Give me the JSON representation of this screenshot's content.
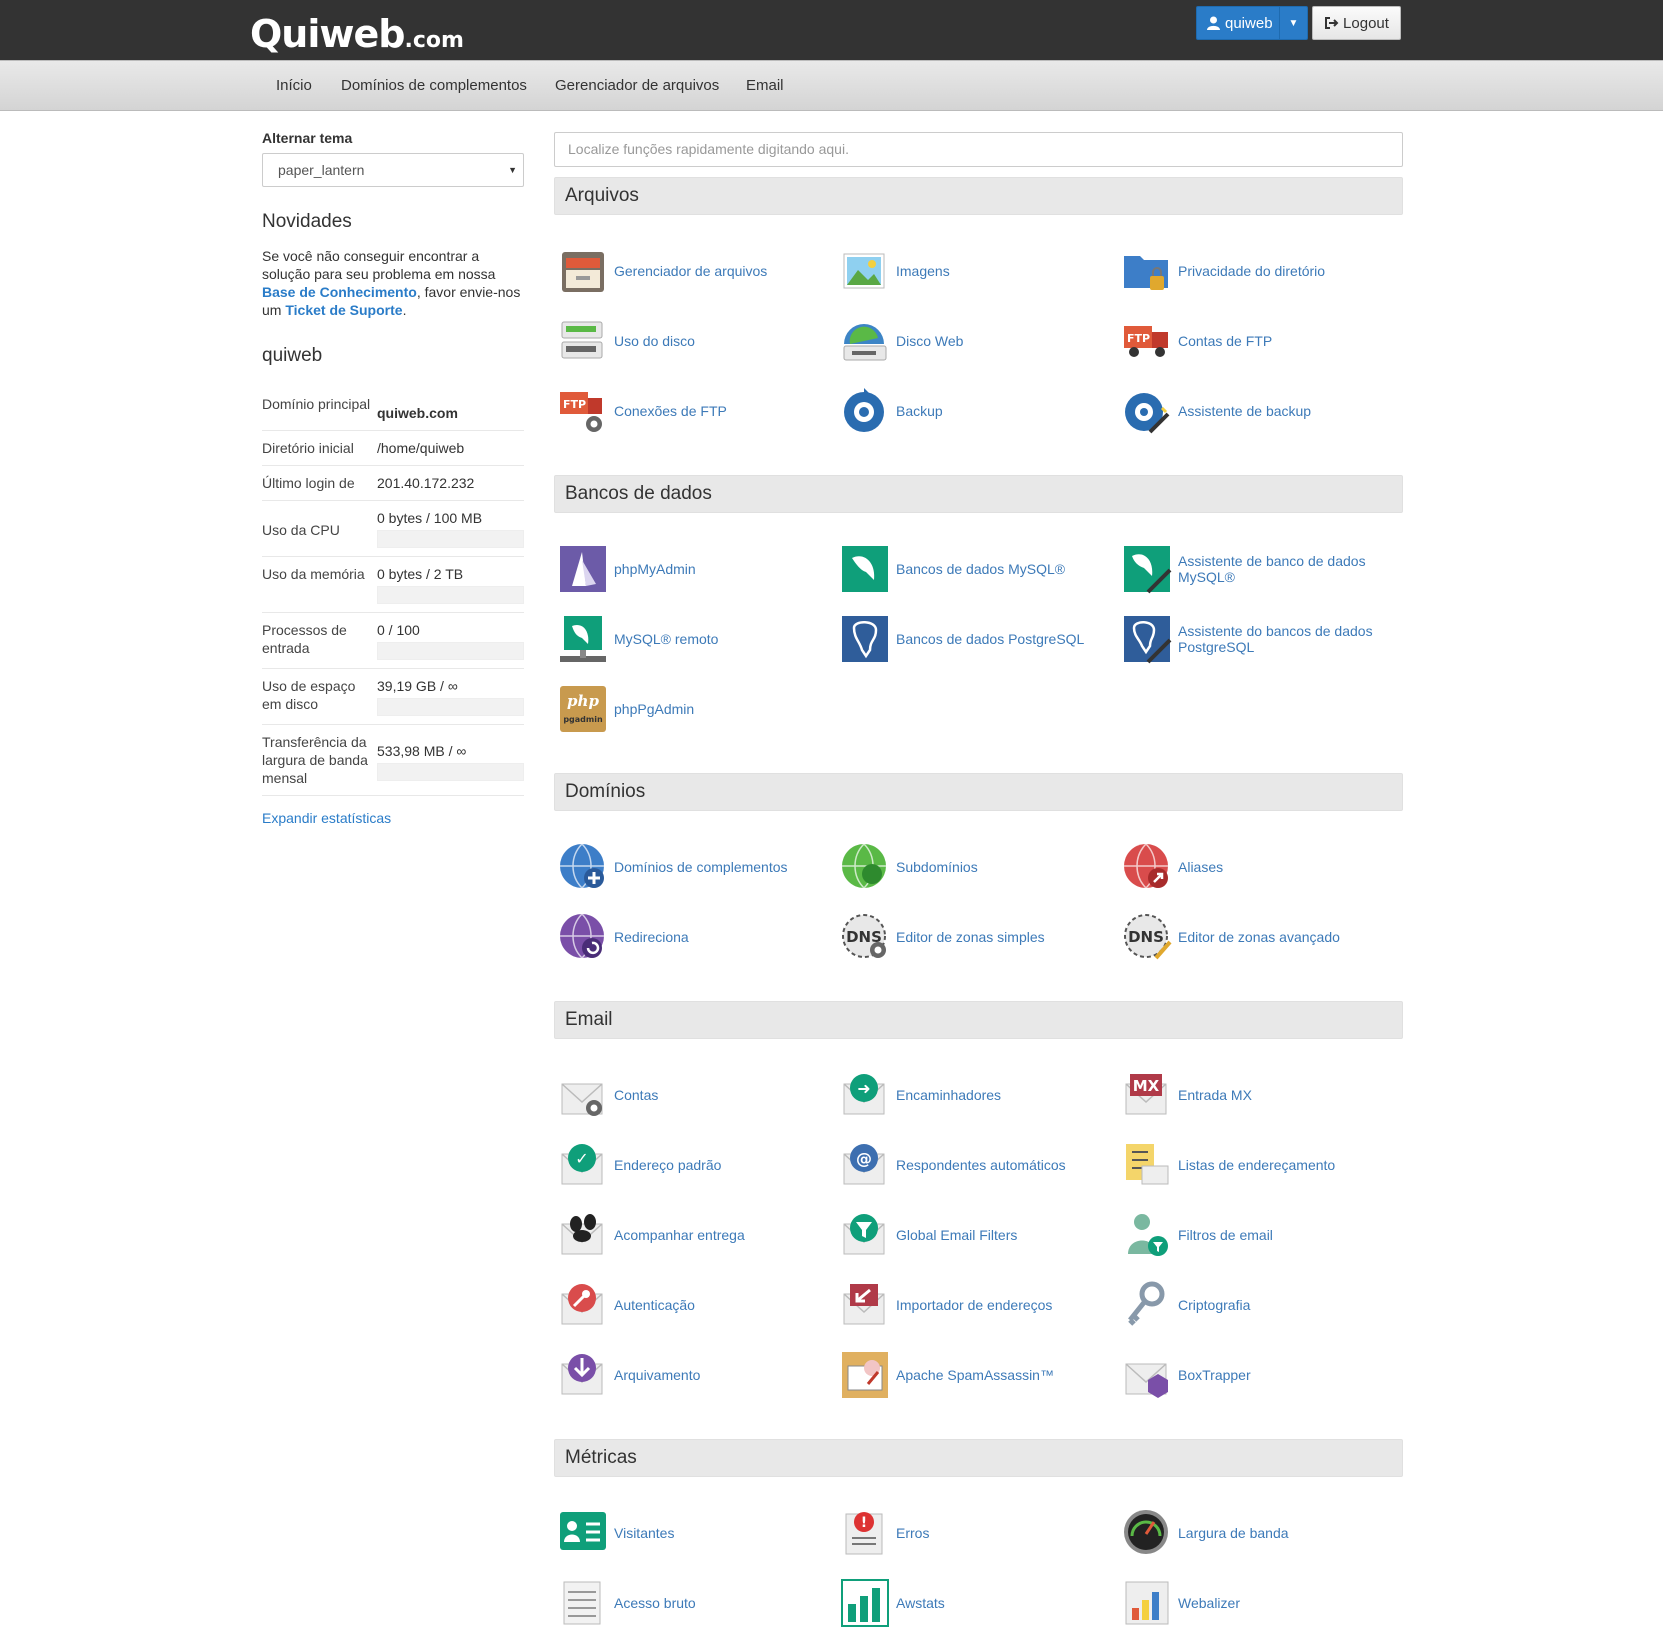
{
  "brand": {
    "name": "Quiweb",
    "suffix": ".com"
  },
  "header": {
    "user_label": "quiweb",
    "logout_label": "Logout"
  },
  "nav": [
    "Início",
    "Domínios de complementos",
    "Gerenciador de arquivos",
    "Email"
  ],
  "sidebar": {
    "theme_label": "Alternar tema",
    "theme_value": "paper_lantern",
    "news_title": "Novidades",
    "news_text_1": "Se você não conseguir encontrar a solução para seu problema em nossa ",
    "news_link_1": "Base de Conhecimento",
    "news_text_2": ", favor envie-nos um ",
    "news_link_2": "Ticket de Suporte",
    "news_text_3": ".",
    "account_title": "quiweb",
    "stats": [
      {
        "label": "Domínio principal",
        "value": "quiweb.com"
      },
      {
        "label": "Diretório inicial",
        "value": "/home/quiweb"
      },
      {
        "label": "Último login de",
        "value": "201.40.172.232"
      },
      {
        "label": "Uso da CPU",
        "value": "0 bytes / 100 MB",
        "progress": 0
      },
      {
        "label": "Uso da memória",
        "value": "0 bytes / 2 TB",
        "progress": 0
      },
      {
        "label": "Processos de entrada",
        "value": "0 / 100",
        "progress": 0
      },
      {
        "label": "Uso de espaço em disco",
        "value": "39,19 GB / ∞",
        "progress": 0
      },
      {
        "label": "Transferência da largura de banda mensal",
        "value": "533,98 MB / ∞",
        "progress": 0
      }
    ],
    "expand_label": "Expandir estatísticas"
  },
  "search": {
    "placeholder": "Localize funções rapidamente digitando aqui."
  },
  "sections": [
    {
      "title": "Arquivos",
      "items": [
        {
          "label": "Gerenciador de arquivos",
          "icon": "file-manager-icon"
        },
        {
          "label": "Imagens",
          "icon": "images-icon"
        },
        {
          "label": "Privacidade do diretório",
          "icon": "directory-privacy-icon"
        },
        {
          "label": "Uso do disco",
          "icon": "disk-usage-icon"
        },
        {
          "label": "Disco Web",
          "icon": "web-disk-icon"
        },
        {
          "label": "Contas de FTP",
          "icon": "ftp-accounts-icon"
        },
        {
          "label": "Conexões de FTP",
          "icon": "ftp-connections-icon"
        },
        {
          "label": "Backup",
          "icon": "backup-icon"
        },
        {
          "label": "Assistente de backup",
          "icon": "backup-wizard-icon"
        }
      ]
    },
    {
      "title": "Bancos de dados",
      "items": [
        {
          "label": "phpMyAdmin",
          "icon": "phpmyadmin-icon"
        },
        {
          "label": "Bancos de dados MySQL®",
          "icon": "mysql-databases-icon"
        },
        {
          "label": "Assistente de banco de dados MySQL®",
          "icon": "mysql-wizard-icon"
        },
        {
          "label": "MySQL® remoto",
          "icon": "remote-mysql-icon"
        },
        {
          "label": "Bancos de dados PostgreSQL",
          "icon": "postgresql-databases-icon"
        },
        {
          "label": "Assistente do bancos de dados PostgreSQL",
          "icon": "postgresql-wizard-icon"
        },
        {
          "label": "phpPgAdmin",
          "icon": "phppgadmin-icon"
        }
      ]
    },
    {
      "title": "Domínios",
      "items": [
        {
          "label": "Domínios de complementos",
          "icon": "addon-domains-icon"
        },
        {
          "label": "Subdomínios",
          "icon": "subdomains-icon"
        },
        {
          "label": "Aliases",
          "icon": "aliases-icon"
        },
        {
          "label": "Redireciona",
          "icon": "redirects-icon"
        },
        {
          "label": "Editor de zonas simples",
          "icon": "simple-zone-editor-icon"
        },
        {
          "label": "Editor de zonas avançado",
          "icon": "advanced-zone-editor-icon"
        }
      ]
    },
    {
      "title": "Email",
      "items": [
        {
          "label": "Contas",
          "icon": "email-accounts-icon"
        },
        {
          "label": "Encaminhadores",
          "icon": "forwarders-icon"
        },
        {
          "label": "Entrada MX",
          "icon": "mx-entry-icon"
        },
        {
          "label": "Endereço padrão",
          "icon": "default-address-icon"
        },
        {
          "label": "Respondentes automáticos",
          "icon": "autoresponders-icon"
        },
        {
          "label": "Listas de endereçamento",
          "icon": "mailing-lists-icon"
        },
        {
          "label": "Acompanhar entrega",
          "icon": "track-delivery-icon"
        },
        {
          "label": "Global Email Filters",
          "icon": "global-email-filters-icon"
        },
        {
          "label": "Filtros de email",
          "icon": "email-filters-icon"
        },
        {
          "label": "Autenticação",
          "icon": "authentication-icon"
        },
        {
          "label": "Importador de endereços",
          "icon": "address-importer-icon"
        },
        {
          "label": "Criptografia",
          "icon": "encryption-icon"
        },
        {
          "label": "Arquivamento",
          "icon": "archive-icon"
        },
        {
          "label": "Apache SpamAssassin™",
          "icon": "spamassassin-icon"
        },
        {
          "label": "BoxTrapper",
          "icon": "boxtrapper-icon"
        }
      ]
    },
    {
      "title": "Métricas",
      "items": [
        {
          "label": "Visitantes",
          "icon": "visitors-icon"
        },
        {
          "label": "Erros",
          "icon": "errors-icon"
        },
        {
          "label": "Largura de banda",
          "icon": "bandwidth-icon"
        },
        {
          "label": "Acesso bruto",
          "icon": "raw-access-icon"
        },
        {
          "label": "Awstats",
          "icon": "awstats-icon"
        },
        {
          "label": "Webalizer",
          "icon": "webalizer-icon"
        }
      ]
    }
  ],
  "colors": {
    "topbar": "#333333",
    "primary": "#2a7cc8",
    "link": "#3d7ab8",
    "section_bg": "#e8e8e8"
  }
}
